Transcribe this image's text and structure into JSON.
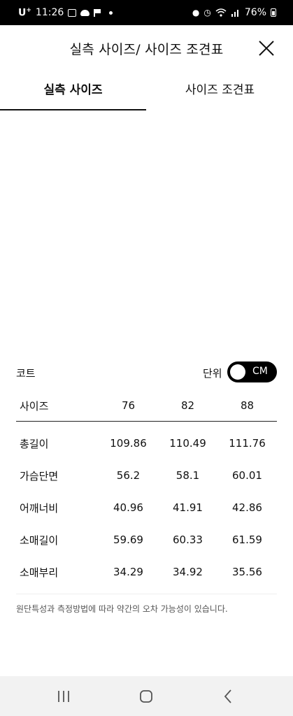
{
  "status_bar": {
    "carrier": "U",
    "carrier_sup": "+",
    "time": "11:26",
    "battery": "76%"
  },
  "header": {
    "title": "실측 사이즈/ 사이즈 조견표"
  },
  "tabs": [
    {
      "label": "실측 사이즈",
      "active": true
    },
    {
      "label": "사이즈 조견표",
      "active": false
    }
  ],
  "product": {
    "name": "코트",
    "unit_label": "단위",
    "unit_value": "CM"
  },
  "table": {
    "header_label": "사이즈",
    "sizes": [
      "76",
      "82",
      "88"
    ],
    "rows": [
      {
        "label": "총길이",
        "values": [
          "109.86",
          "110.49",
          "111.76"
        ]
      },
      {
        "label": "가슴단면",
        "values": [
          "56.2",
          "58.1",
          "60.01"
        ]
      },
      {
        "label": "어깨너비",
        "values": [
          "40.96",
          "41.91",
          "42.86"
        ]
      },
      {
        "label": "소매길이",
        "values": [
          "59.69",
          "60.33",
          "61.59"
        ]
      },
      {
        "label": "소매부리",
        "values": [
          "34.29",
          "34.92",
          "35.56"
        ]
      }
    ]
  },
  "note": "원단특성과 측정방법에 따라 약간의 오차 가능성이 있습니다."
}
